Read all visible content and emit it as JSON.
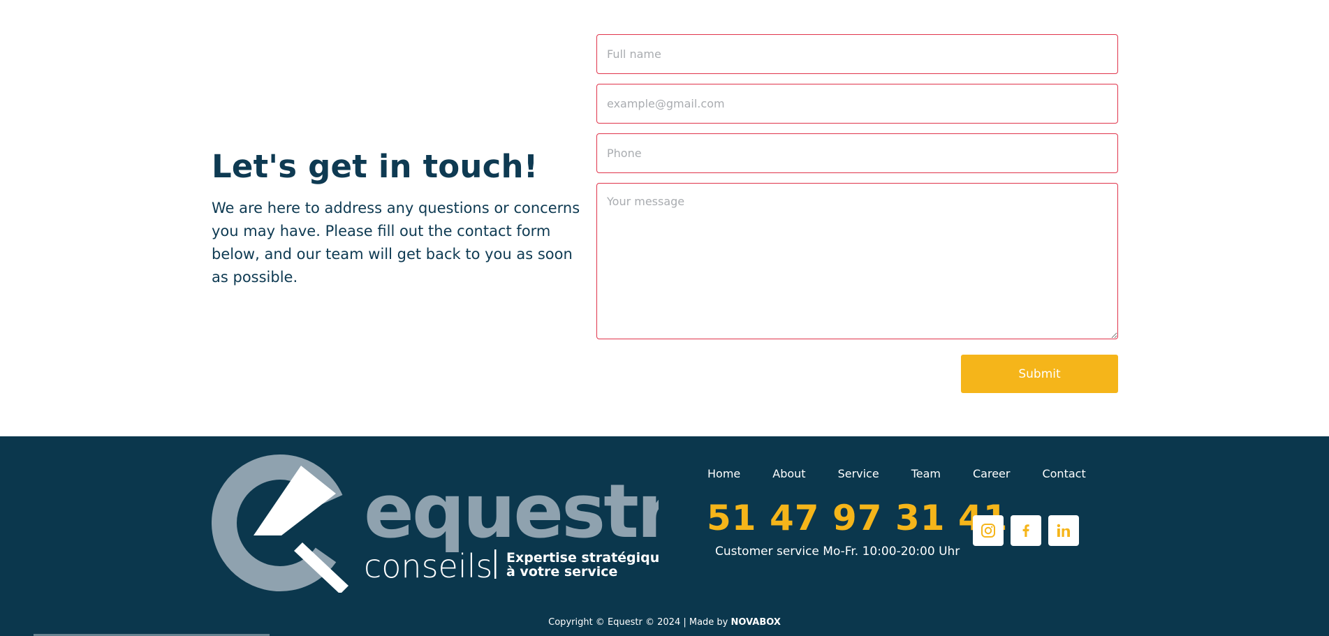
{
  "contact": {
    "heading": "Let's get in touch!",
    "description": "We are here to address any questions or concerns you may have. Please fill out the contact form below, and our team will get back to you as soon as possible.",
    "form": {
      "full_name_placeholder": "Full name",
      "email_placeholder": "example@gmail.com",
      "phone_placeholder": "Phone",
      "message_placeholder": "Your message",
      "full_name_value": "",
      "email_value": "",
      "phone_value": "",
      "message_value": "",
      "submit_label": "Submit"
    }
  },
  "footer": {
    "logo": {
      "brand": "equestr",
      "sub": "conseils",
      "tagline_line1": "Expertise stratégique",
      "tagline_line2": "à votre service"
    },
    "nav": [
      "Home",
      "About",
      "Service",
      "Team",
      "Career",
      "Contact"
    ],
    "phone": "51 47 97 31 41",
    "hours": "Customer service Mo-Fr. 10:00-20:00 Uhr",
    "socials": [
      "instagram-icon",
      "facebook-icon",
      "linkedin-icon"
    ],
    "copyright_prefix": "Copyright © Equestr © 2024 | Made by ",
    "copyright_maker": "NOVABOX"
  },
  "colors": {
    "navy": "#0b374d",
    "accent": "#f5b51a",
    "field_border": "#e0344b",
    "logo_grey": "#8fa2af"
  }
}
